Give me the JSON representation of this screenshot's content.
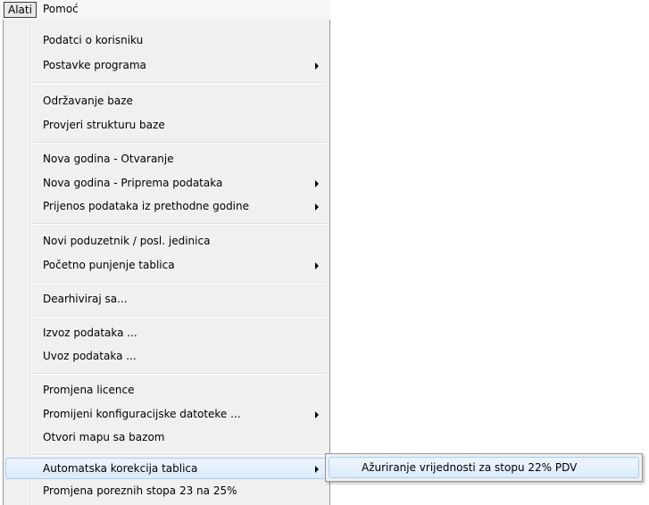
{
  "menubar": {
    "items": [
      {
        "label": "Alati"
      },
      {
        "label": "Pomoć"
      }
    ]
  },
  "menu": {
    "items": [
      {
        "label": "Podatci o korisniku"
      },
      {
        "label": "Postavke programa"
      },
      {
        "label": "Održavanje baze"
      },
      {
        "label": "Provjeri strukturu baze"
      },
      {
        "label": "Nova godina - Otvaranje"
      },
      {
        "label": "Nova godina - Priprema podataka"
      },
      {
        "label": "Prijenos podataka iz prethodne godine"
      },
      {
        "label": "Novi poduzetnik / posl. jedinica"
      },
      {
        "label": "Početno punjenje tablica"
      },
      {
        "label": "Dearhiviraj sa..."
      },
      {
        "label": "Izvoz podataka ..."
      },
      {
        "label": "Uvoz podataka ..."
      },
      {
        "label": "Promjena licence"
      },
      {
        "label": "Promijeni konfiguracijske datoteke ..."
      },
      {
        "label": "Otvori mapu sa bazom"
      },
      {
        "label": "Automatska korekcija tablica"
      },
      {
        "label": "Promjena poreznih stopa 23 na 25%"
      }
    ]
  },
  "submenu": {
    "items": [
      {
        "label": "Ažuriranje vrijednosti za stopu 22% PDV"
      }
    ]
  }
}
